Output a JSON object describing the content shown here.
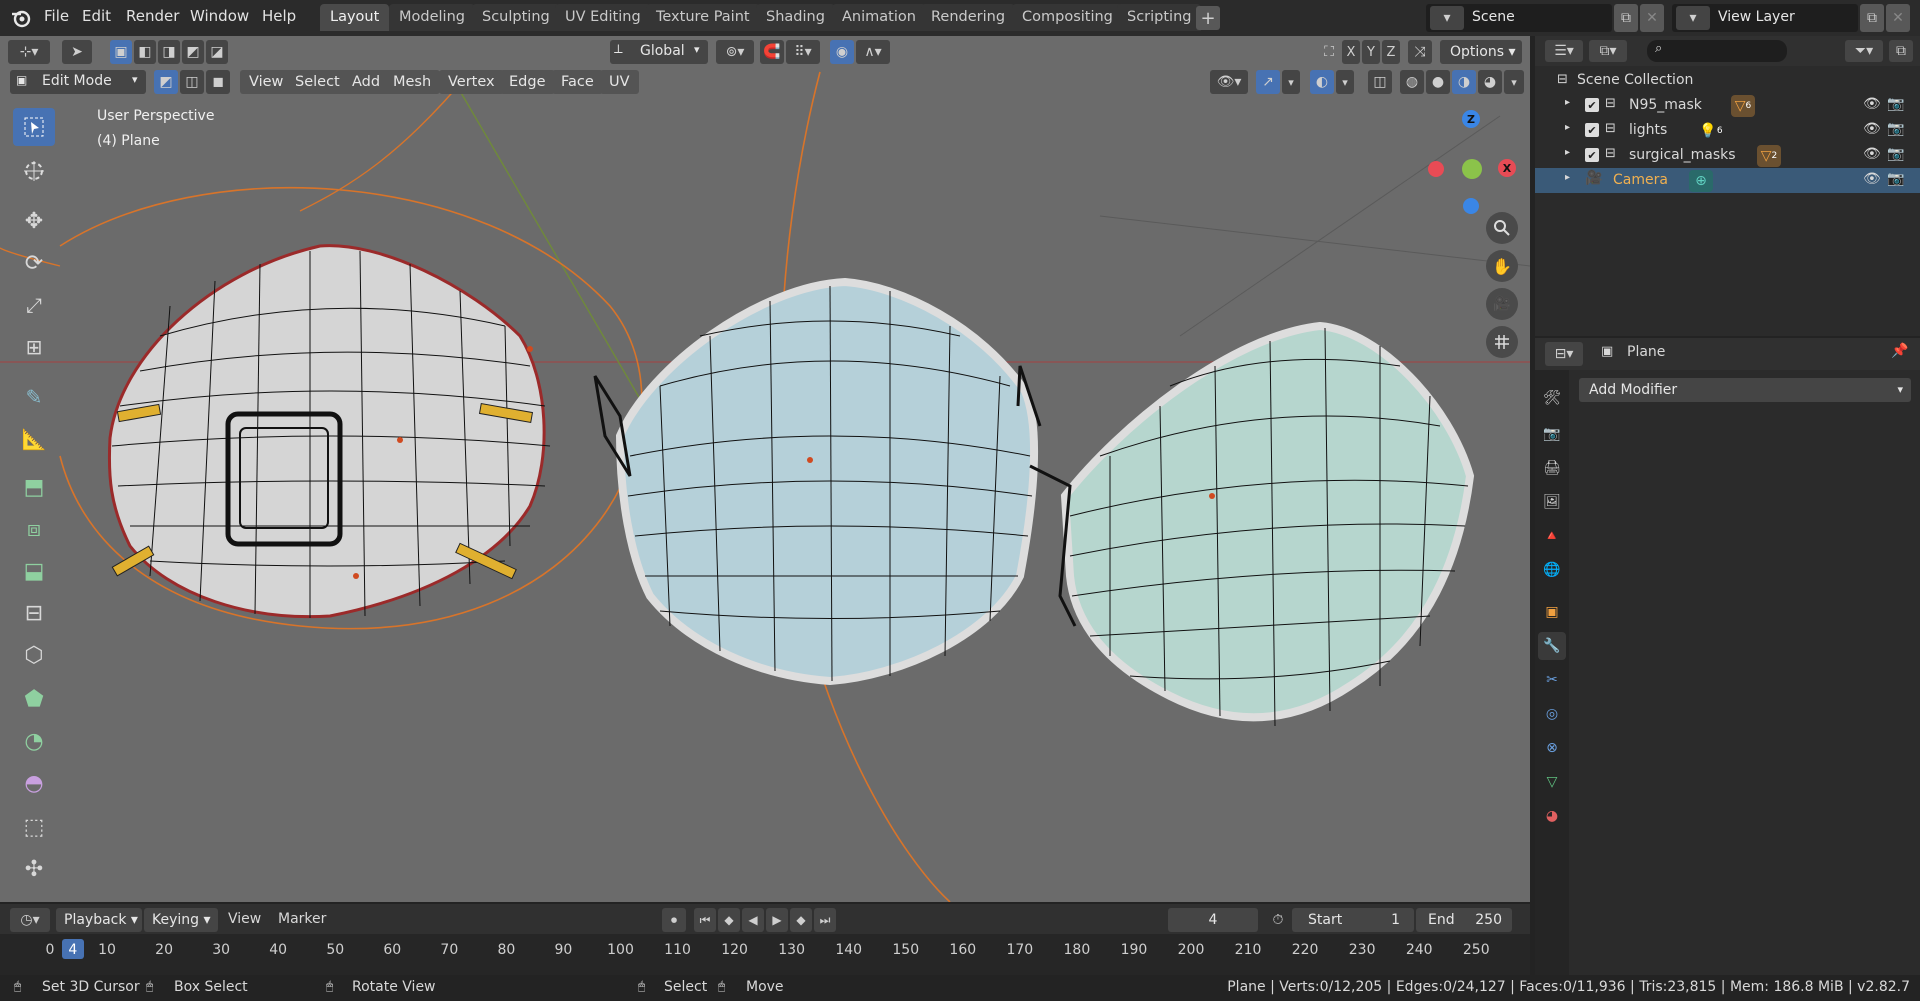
{
  "app": {
    "logo": "blender-logo-icon"
  },
  "menu": [
    "File",
    "Edit",
    "Render",
    "Window",
    "Help"
  ],
  "workspaces": [
    "Layout",
    "Modeling",
    "Sculpting",
    "UV Editing",
    "Texture Paint",
    "Shading",
    "Animation",
    "Rendering",
    "Compositing",
    "Scripting"
  ],
  "active_workspace": "Layout",
  "scene": {
    "name": "Scene",
    "view_layer": "View Layer"
  },
  "viewport": {
    "mode": "Edit Mode",
    "menus": [
      "View",
      "Select",
      "Add",
      "Mesh",
      "Vertex",
      "Edge",
      "Face",
      "UV"
    ],
    "orientation": "Global",
    "options_label": "Options",
    "axes": [
      "X",
      "Y",
      "Z"
    ],
    "overlay_title": "User Perspective",
    "overlay_object": "(4) Plane",
    "gizmo_labels": {
      "z": "Z",
      "x": "X"
    },
    "colors": {
      "bg": "#6b6b6b",
      "accent": "#4772b3",
      "x_axis": "#e84b55",
      "y_axis": "#8bc34a",
      "z_axis": "#3a86e6",
      "wire": "#111111",
      "face_blue": "#bcd4dc",
      "face_green": "#b9d8d0"
    }
  },
  "outliner": {
    "root": "Scene Collection",
    "items": [
      {
        "name": "N95_mask",
        "badge": "6",
        "selected": false
      },
      {
        "name": "lights",
        "badge": "6",
        "selected": false
      },
      {
        "name": "surgical_masks",
        "badge": "2",
        "selected": false
      },
      {
        "name": "Camera",
        "badge": "",
        "selected": true
      }
    ]
  },
  "properties": {
    "object_name": "Plane",
    "add_modifier_label": "Add Modifier"
  },
  "timeline": {
    "menus": [
      "Playback",
      "Keying",
      "View",
      "Marker"
    ],
    "current_frame": "4",
    "start_label": "Start",
    "start": "1",
    "end_label": "End",
    "end": "250",
    "ruler": [
      "0",
      "4",
      "10",
      "20",
      "30",
      "40",
      "50",
      "60",
      "70",
      "80",
      "90",
      "100",
      "110",
      "120",
      "130",
      "140",
      "150",
      "160",
      "170",
      "180",
      "190",
      "200",
      "210",
      "220",
      "230",
      "240",
      "250"
    ]
  },
  "statusbar": {
    "hints": [
      "Set 3D Cursor",
      "Box Select",
      "Rotate View",
      "Select",
      "Move"
    ],
    "stats": "Plane | Verts:0/12,205 | Edges:0/24,127 | Faces:0/11,936 | Tris:23,815 | Mem: 186.8 MiB | v2.82.7"
  }
}
